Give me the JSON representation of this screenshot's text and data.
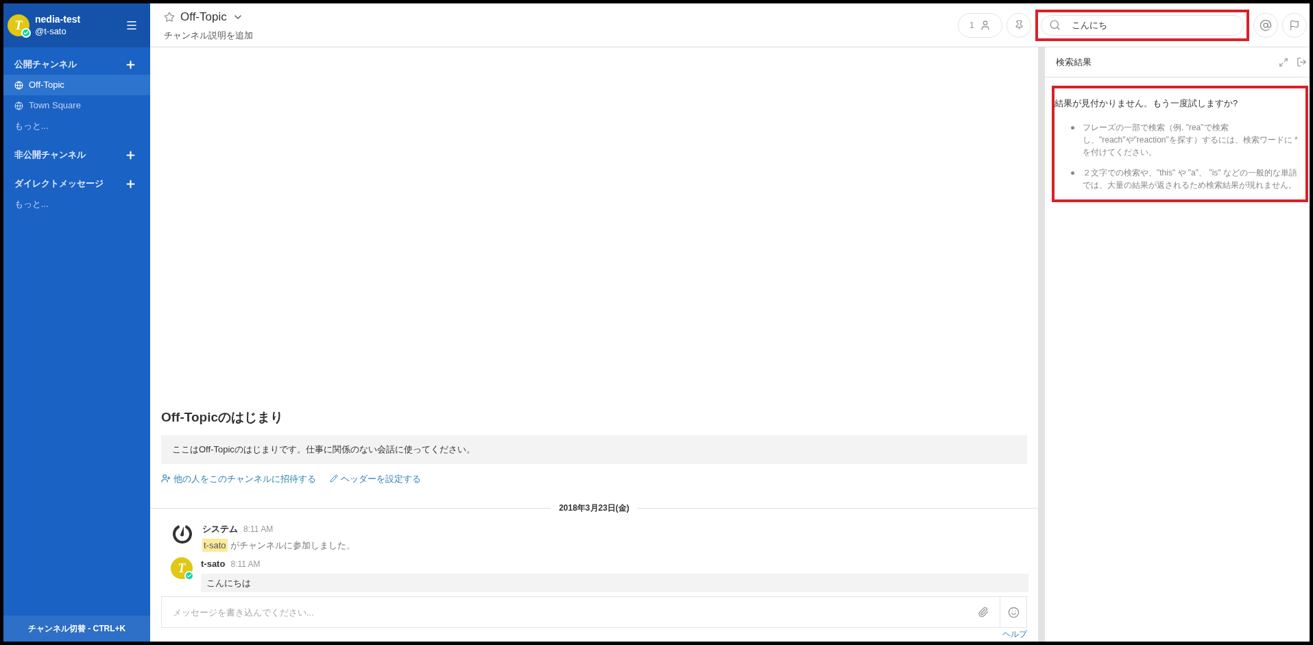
{
  "team": {
    "name": "nedia-test",
    "username": "@t-sato",
    "avatar_initial": "T",
    "online": true
  },
  "sidebar": {
    "sections": [
      {
        "title": "公開チャンネル",
        "items": [
          {
            "label": "Off-Topic",
            "selected": true
          },
          {
            "label": "Town Square",
            "selected": false
          }
        ],
        "more": "もっと..."
      },
      {
        "title": "非公開チャンネル"
      },
      {
        "title": "ダイレクトメッセージ",
        "more": "もっと..."
      }
    ],
    "switcher": "チャンネル切替 - CTRL+K"
  },
  "header": {
    "channel_name": "Off-Topic",
    "description": "チャンネル説明を追加",
    "member_count": "1",
    "search": {
      "value": "こんにち",
      "highlighted": true
    }
  },
  "channel_intro": {
    "title": "Off-Topicのはじまり",
    "text": "ここはOff-Topicのはじまりです。仕事に関係のない会話に使ってください。",
    "actions": [
      {
        "kind": "invite",
        "label": "他の人をこのチャンネルに招待する"
      },
      {
        "kind": "header",
        "label": "ヘッダーを設定する"
      }
    ]
  },
  "date_separator": "2018年3月23日(金)",
  "messages": [
    {
      "kind": "system",
      "author": "システム",
      "time": "8:11 AM",
      "mention": "t-sato",
      "text": "がチャンネルに参加しました。"
    },
    {
      "kind": "user",
      "author": "t-sato",
      "avatar_initial": "T",
      "online": true,
      "time": "8:11 AM",
      "text": "こんにちは"
    }
  ],
  "composer": {
    "placeholder": "メッセージを書き込んでください...",
    "help_link": "ヘルプ"
  },
  "search_results": {
    "title": "検索結果",
    "highlighted": true,
    "heading": "結果が見付かりません。もう一度試しますか?",
    "tips": [
      "フレーズの一部で検索（例. \"rea\"で検索し、\"reach\"や\"reaction\"を探す）するには、検索ワードに * を付けてください。",
      "２文字での検索や、\"this\" や \"a\"、 \"is\" などの一般的な単語では、大量の結果が返されるため検索結果が現れません。"
    ]
  }
}
